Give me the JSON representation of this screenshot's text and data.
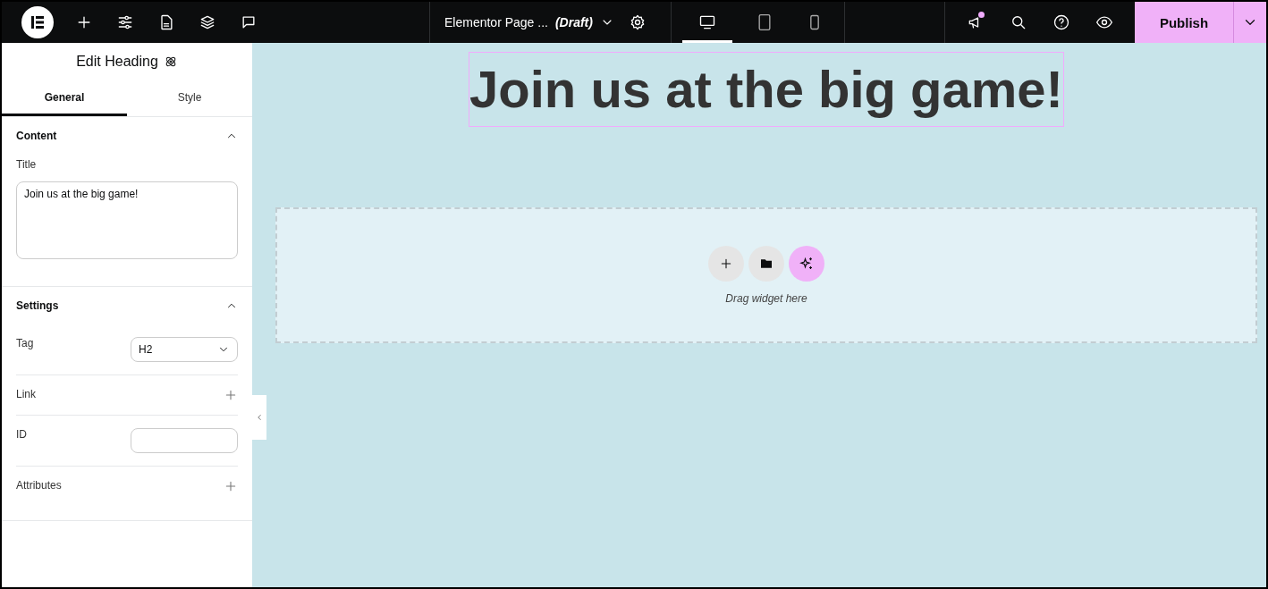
{
  "topbar": {
    "tools": [
      {
        "kind": "add"
      },
      {
        "kind": "settings"
      },
      {
        "kind": "page"
      },
      {
        "kind": "layers"
      },
      {
        "kind": "comments"
      }
    ],
    "page_title": "Elementor Page ...",
    "page_status": "(Draft)",
    "devices": [
      {
        "kind": "desktop",
        "selected": true
      },
      {
        "kind": "tablet",
        "selected": false
      },
      {
        "kind": "mobile",
        "selected": false
      }
    ],
    "notifications_unread": true,
    "publish": "Publish"
  },
  "panel": {
    "title": "Edit Heading",
    "tabs": [
      {
        "label": "General",
        "selected": true
      },
      {
        "label": "Style",
        "selected": false
      }
    ],
    "sections": [
      {
        "title": "Content",
        "expanded": true,
        "controls": [
          {
            "kind": "textarea",
            "label": "Title",
            "value": "Join us at the big game!"
          }
        ]
      },
      {
        "title": "Settings",
        "expanded": true,
        "controls": [
          {
            "kind": "select",
            "label": "Tag",
            "value": "H2"
          },
          {
            "kind": "add",
            "label": "Link"
          },
          {
            "kind": "input",
            "label": "ID"
          },
          {
            "kind": "add",
            "label": "Attributes"
          }
        ]
      }
    ]
  },
  "canvas": {
    "heading": "Join us at the big game!",
    "dropzone": {
      "hint": "Drag widget here"
    }
  }
}
